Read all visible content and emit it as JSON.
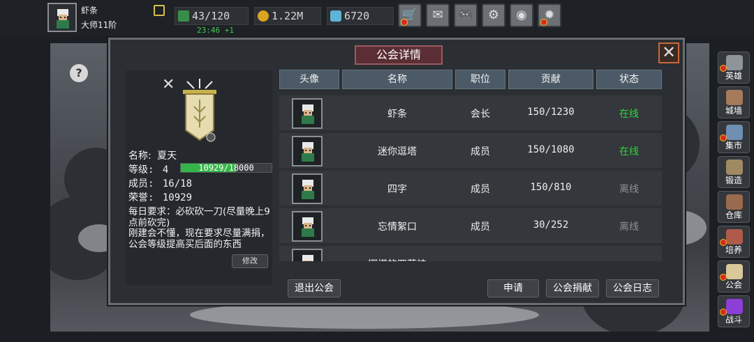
{
  "player": {
    "name": "虾条",
    "rank": "大师11阶"
  },
  "resources": {
    "stamina": "43/120",
    "stamina_timer": "23:46 +1",
    "gold": "1.22M",
    "gems": "6720"
  },
  "top_buttons": [
    {
      "icon": "shop-cart-icon",
      "glyph": "🛒",
      "badge": true
    },
    {
      "icon": "mail-icon",
      "glyph": "✉",
      "badge": false
    },
    {
      "icon": "gamepad-icon",
      "glyph": "🎮",
      "badge": false
    },
    {
      "icon": "gear-icon",
      "glyph": "⚙",
      "badge": false
    },
    {
      "icon": "color-wheel-icon",
      "glyph": "◉",
      "badge": false
    },
    {
      "icon": "firework-icon",
      "glyph": "✹",
      "badge": true
    }
  ],
  "side_menu": [
    {
      "label": "英雄",
      "icon": "helmet-icon",
      "color": "#8f949a",
      "badge": true
    },
    {
      "label": "城墙",
      "icon": "wall-icon",
      "color": "#a67b5b",
      "badge": false
    },
    {
      "label": "集市",
      "icon": "market-icon",
      "color": "#6f8fb3",
      "badge": true
    },
    {
      "label": "锻造",
      "icon": "anvil-icon",
      "color": "#a08a63",
      "badge": false
    },
    {
      "label": "仓库",
      "icon": "warehouse-icon",
      "color": "#9a6a4e",
      "badge": false
    },
    {
      "label": "培养",
      "icon": "training-icon",
      "color": "#b05a4a",
      "badge": true
    },
    {
      "label": "公会",
      "icon": "guild-icon",
      "color": "#d8c89a",
      "badge": true
    },
    {
      "label": "战斗",
      "icon": "portal-icon",
      "color": "#8b3fd6",
      "badge": true
    }
  ],
  "dialog": {
    "title": "公会详情",
    "guild": {
      "name_label": "名称:",
      "name": "夏天",
      "level_label": "等级:",
      "level": "4",
      "xp_text": "10929/18000",
      "xp_fraction": 0.607,
      "members_label": "成员:",
      "members": "16/18",
      "honor_label": "荣誉:",
      "honor": "10929",
      "description": "每日要求：必砍砍一刀(尽量晚上9点前砍完)\n刚建会不懂，现在要求尽量满捐，公会等级提高买后面的东西",
      "modify_label": "修改"
    },
    "columns": [
      "头像",
      "名称",
      "职位",
      "贡献",
      "状态"
    ],
    "members": [
      {
        "name": "虾条",
        "role": "会长",
        "contribution": "150/1230",
        "status": "在线",
        "online": true
      },
      {
        "name": "迷你逗塔",
        "role": "成员",
        "contribution": "150/1080",
        "status": "在线",
        "online": true
      },
      {
        "name": "四字",
        "role": "成员",
        "contribution": "150/810",
        "status": "离线",
        "online": false
      },
      {
        "name": "忘情絮口",
        "role": "成员",
        "contribution": "30/252",
        "status": "离线",
        "online": false
      },
      {
        "name": "挪塔的四萝桂",
        "role": "",
        "contribution": "",
        "status": "",
        "online": false
      }
    ],
    "buttons": {
      "leave": "退出公会",
      "apply": "申请",
      "donate": "公会捐献",
      "log": "公会日志"
    }
  },
  "colors": {
    "online": "#2ed63c",
    "offline": "#8e9195",
    "xp_bar": "#35b547"
  }
}
